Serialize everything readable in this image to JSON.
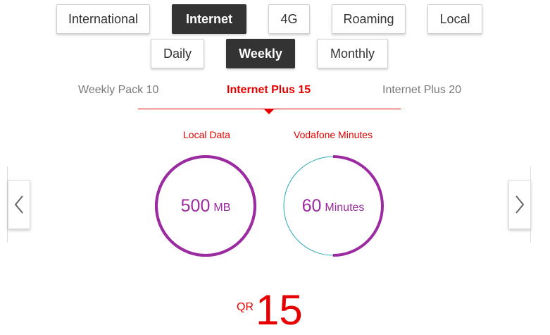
{
  "category_tabs": [
    {
      "label": "International",
      "active": false
    },
    {
      "label": "Internet",
      "active": true
    },
    {
      "label": "4G",
      "active": false
    },
    {
      "label": "Roaming",
      "active": false
    },
    {
      "label": "Local",
      "active": false
    }
  ],
  "period_tabs": [
    {
      "label": "Daily",
      "active": false
    },
    {
      "label": "Weekly",
      "active": true
    },
    {
      "label": "Monthly",
      "active": false
    }
  ],
  "packs": [
    {
      "label": "Weekly Pack 10",
      "active": false
    },
    {
      "label": "Internet Plus 15",
      "active": true
    },
    {
      "label": "Internet Plus 20",
      "active": false
    }
  ],
  "allowances": [
    {
      "title": "Local Data",
      "value": "500",
      "unit": "MB",
      "fill_fraction": 1.0
    },
    {
      "title": "Vodafone Minutes",
      "value": "60",
      "unit": "Minutes",
      "fill_fraction": 0.5
    }
  ],
  "price": {
    "currency": "QR",
    "amount": "15"
  },
  "colors": {
    "brand_red": "#e60000",
    "purple": "#9c2aa0",
    "teal_track": "#2aa8b5",
    "active_tab_bg": "#333333"
  },
  "icons": {
    "prev": "chevron-left-icon",
    "next": "chevron-right-icon"
  }
}
